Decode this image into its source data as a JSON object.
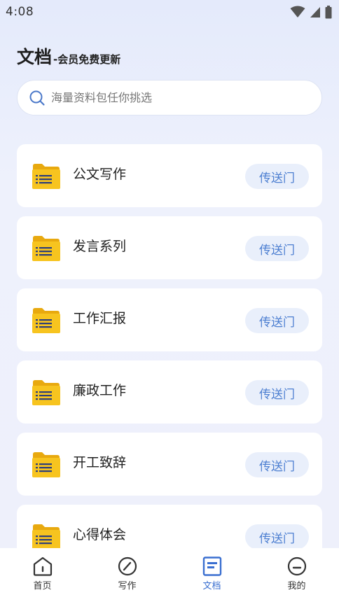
{
  "status_bar": {
    "time": "4:08"
  },
  "header": {
    "title": "文档",
    "subtitle": "-会员免费更新"
  },
  "search": {
    "placeholder": "海量资料包任你挑选"
  },
  "categories": [
    {
      "title": "公文写作",
      "button": "传送门"
    },
    {
      "title": "发言系列",
      "button": "传送门"
    },
    {
      "title": "工作汇报",
      "button": "传送门"
    },
    {
      "title": "廉政工作",
      "button": "传送门"
    },
    {
      "title": "开工致辞",
      "button": "传送门"
    },
    {
      "title": "心得体会",
      "button": "传送门"
    }
  ],
  "tabs": [
    {
      "label": "首页",
      "icon": "home-icon",
      "active": false
    },
    {
      "label": "写作",
      "icon": "compass-icon",
      "active": false
    },
    {
      "label": "文档",
      "icon": "document-icon",
      "active": true
    },
    {
      "label": "我的",
      "icon": "profile-icon",
      "active": false
    }
  ],
  "colors": {
    "accent": "#3a6fd0",
    "button_bg": "#e9effb",
    "button_text": "#4d7fd1",
    "folder": "#f7c41f"
  }
}
